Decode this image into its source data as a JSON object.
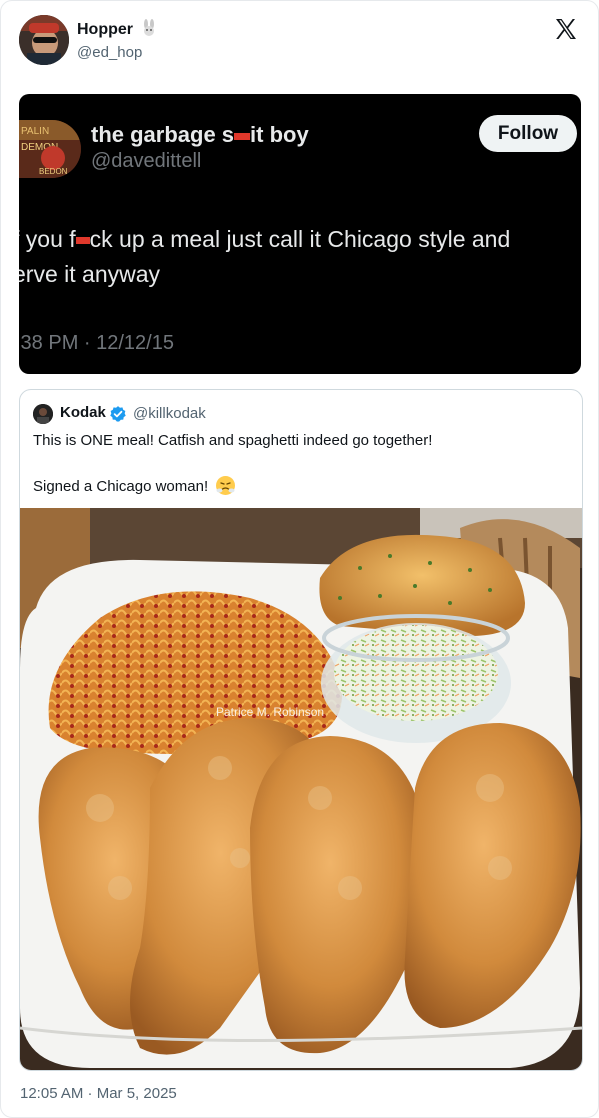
{
  "post": {
    "author_name": "Hopper",
    "author_handle": "@ed_hop",
    "timestamp": "12:05 AM · Mar 5, 2025"
  },
  "embedded_tweet": {
    "name_part1": "the garbage s",
    "name_part2": "it boy",
    "handle": "@davedittell",
    "follow_label": "Follow",
    "line1_part1": "f you f",
    "line1_part2": "ck up a meal just call it Chicago style and",
    "line2": "erve it anyway",
    "timestamp": ":38 PM · 12/12/15"
  },
  "quote_tweet": {
    "name": "Kodak",
    "handle": "@killkodak",
    "text_line1": "This is ONE meal! Catfish and spaghetti indeed go together!",
    "text_line2": "Signed a Chicago woman!",
    "photo_watermark": "Patrice M. Robinson"
  },
  "colors": {
    "verified_blue": "#1d9bf0",
    "redaction_red": "#e0382b",
    "dark_bg": "#000000"
  },
  "icons": [
    "x-logo-icon",
    "rabbit-emoji-icon",
    "verified-badge-icon",
    "steam-from-nose-emoji-icon"
  ]
}
